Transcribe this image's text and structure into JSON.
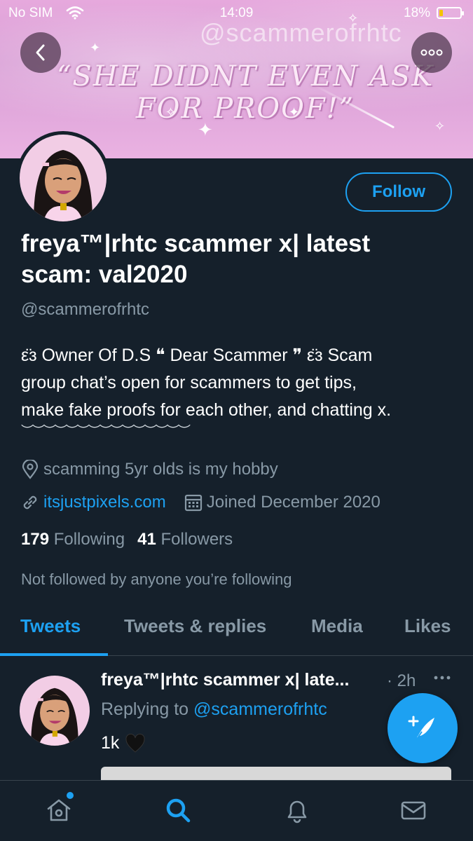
{
  "status_bar": {
    "carrier": "No SIM",
    "time": "14:09",
    "battery_pct": "18%",
    "battery_level": 0.18
  },
  "banner": {
    "handle_watermark": "@scammerofrhtc",
    "quote": "“SHE DIDNT EVEN ASK FOR PROOF!”"
  },
  "profile": {
    "follow_label": "Follow",
    "name_line1": "freya™|rhtc scammer x| latest",
    "name_line2": "scam: val2020",
    "handle": "@scammerofrhtc",
    "bio_line1": "ε̈ɜ Owner Of D.S ❝ Dear Scammer ❞ ε̈ɜ Scam",
    "bio_line2": "group chat’s open for scammers to get tips,",
    "bio_line3": "make fake proofs for each other, and chatting x.",
    "bio_line4": "︶︶︶︶︶︶︶︶︶︶︶︶︶︶︶",
    "location": "scamming 5yr olds is my hobby",
    "website": "itsjustpixels.com",
    "joined": "Joined December 2020",
    "following_count": "179",
    "following_label": "Following",
    "followers_count": "41",
    "followers_label": "Followers",
    "not_followed": "Not followed by anyone you’re following"
  },
  "tabs": [
    {
      "label": "Tweets",
      "active": true
    },
    {
      "label": "Tweets & replies",
      "active": false
    },
    {
      "label": "Media",
      "active": false
    },
    {
      "label": "Likes",
      "active": false
    }
  ],
  "tweet": {
    "name": "freya™|rhtc scammer x| late...",
    "time": "· 2h",
    "replying_prefix": "Replying to",
    "replying_handle": "@scammerofrhtc",
    "text": "1k",
    "emoji_icon": "black-heart-icon"
  },
  "icons": {
    "back": "chevron-left-icon",
    "more": "more-dots-icon",
    "location": "location-pin-icon",
    "link": "link-icon",
    "calendar": "calendar-icon",
    "compose": "compose-tweet-icon",
    "nav": [
      "home-icon",
      "search-icon",
      "bell-icon",
      "mail-icon"
    ]
  },
  "colors": {
    "background": "#15202b",
    "accent": "#1da1f2",
    "secondary_text": "#8899a6",
    "banner_pink": "#e6a9dd"
  }
}
